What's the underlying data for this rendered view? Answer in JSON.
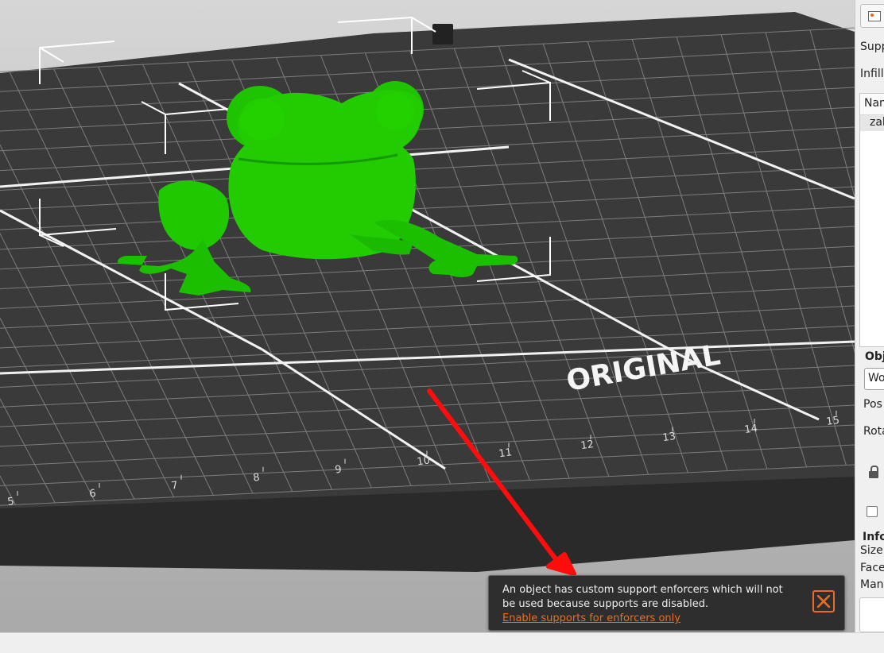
{
  "viewport": {
    "bed_label": "ORIGINAL",
    "ruler_ticks": [
      "5",
      "6",
      "7",
      "8",
      "9",
      "10",
      "11",
      "12",
      "13",
      "14",
      "15"
    ],
    "model_color": "#22cc00"
  },
  "sidebar": {
    "support_label": "Supp",
    "infill_label": "Infill",
    "object_list": {
      "name_header": "Nam",
      "items": [
        {
          "name": "zab"
        }
      ]
    },
    "object_manipulation": {
      "group_label": "Obj",
      "coordinates_value": "Wo",
      "position_label": "Pos",
      "rotation_label": "Rota"
    },
    "info": {
      "group_label": "Info",
      "size_label": "Size:",
      "facets_label": "Face",
      "manifold_label": "Man"
    }
  },
  "notification": {
    "message": "An object has custom support enforcers which will not be used because supports are disabled.",
    "link_text": "Enable supports for enforcers only",
    "accent_color": "#ed6b21"
  },
  "icons": [
    "close-icon",
    "lock-icon",
    "layout-icon"
  ]
}
